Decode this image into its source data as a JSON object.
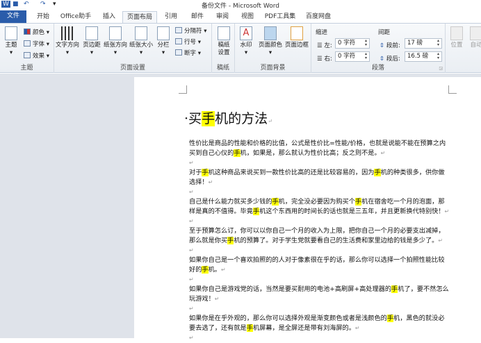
{
  "window": {
    "title": "备份文件 - Microsoft Word"
  },
  "quick_access": {
    "undo": "↶",
    "redo": "↷",
    "more": "▾"
  },
  "tabs": [
    "文件",
    "开始",
    "Office助手",
    "插入",
    "页面布局",
    "引用",
    "邮件",
    "审阅",
    "视图",
    "PDF工具集",
    "百度网盘"
  ],
  "active_tab": "页面布局",
  "ribbon": {
    "theme": {
      "label": "主题",
      "theme_btn": "主题",
      "colors": "颜色",
      "fonts": "字体",
      "effects": "效果"
    },
    "page_setup": {
      "label": "页面设置",
      "text_direction": "文字方向",
      "margins": "页边距",
      "orientation": "纸张方向",
      "size": "纸张大小",
      "columns": "分栏",
      "breaks": "分隔符",
      "line_numbers": "行号",
      "hyphenation": "断字"
    },
    "manuscript": {
      "label": "稿纸",
      "settings": "稿纸\n设置"
    },
    "page_background": {
      "label": "页面背景",
      "watermark": "水印",
      "page_color": "页面颜色",
      "page_borders": "页面边框"
    },
    "paragraph": {
      "label": "段落",
      "indent": "缩进",
      "left": "左:",
      "right": "右:",
      "left_value": "0 字符",
      "right_value": "0 字符",
      "spacing": "间距",
      "before": "段前:",
      "after": "段后:",
      "before_value": "17 磅",
      "after_value": "16.5 磅"
    },
    "arrange": {
      "position": "位置",
      "wrap": "自动"
    }
  },
  "document": {
    "title": "·买手机的方法",
    "highlight_color": "#ffff00",
    "lines": [
      "性价比是商品的性能和价格的比值，公式是性价比=性能/价格，也就是说能不能在预算之内",
      "买到自己心仪的手机，如果是，那么就认为性价比高；反之则不是。↵",
      " ↵",
      "对于手机这种商品来说买到一款性价比高的还是比较容易的，因为手机的种类很多，供你做",
      "选择！↵",
      "↵",
      "自己是什么能力就买多少钱的手机，完全没必要因为购买个手机在宿舍吃一个月的泡面，那",
      "样是真的不值得。毕竟手机这个东西用的时间长的话也就是三五年，并且更新换代特别快！↵",
      "↵",
      "至于预算怎么订，你可以以你自己一个月的收入为上限，把你自己一个月的必要支出减掉，",
      "那么就是你买手机的预算了。对于学生党就要看自己的生活费和家里边给的钱是多少了。↵",
      "↵",
      "如果你自己是一个喜欢拍照的的人对于像素很在乎的话，那么你可以选择一个拍照性能比较",
      "好的手机。↵",
      "↵",
      "如果你自己是游戏党的话，当然是要买耐用的电池+高刷屏+高处理器的手机了，要不然怎么",
      "玩游戏！↵",
      "↵",
      "如果你是在乎外观的，那么你可以选择外观是渐变颜色或者是浅颜色的手机，黑色的就没必",
      "要去选了，还有就是手机屏幕，是全屏还是带有刘海屏的。↵",
      "↵"
    ]
  }
}
